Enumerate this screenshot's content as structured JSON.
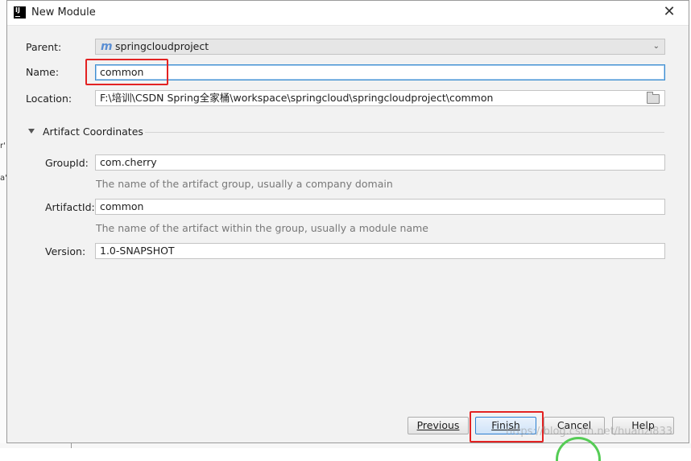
{
  "window": {
    "title": "New Module",
    "app_icon_text": "IJ",
    "close_glyph": "✕"
  },
  "form": {
    "parent_label": "Parent:",
    "parent_value": "springcloudproject",
    "parent_icon": "m",
    "name_label": "Name:",
    "name_value": "common",
    "location_label": "Location:",
    "location_value": "F:\\培训\\CSDN Spring全家桶\\workspace\\springcloud\\springcloudproject\\common"
  },
  "artifact": {
    "section_title": "Artifact Coordinates",
    "groupid_label": "GroupId:",
    "groupid_value": "com.cherry",
    "groupid_hint": "The name of the artifact group, usually a company domain",
    "artifactid_label": "ArtifactId:",
    "artifactid_value": "common",
    "artifactid_hint": "The name of the artifact within the group, usually a module name",
    "version_label": "Version:",
    "version_value": "1.0-SNAPSHOT"
  },
  "buttons": {
    "previous_label": "Previous",
    "finish_label": "Finish",
    "cancel_label": "Cancel",
    "help_label": "Help"
  },
  "background": {
    "left_glyph_1": "r'",
    "left_glyph_2": "a'",
    "watermark": "https://blog.csdn.net/huanzi833"
  },
  "colors": {
    "highlight": "#e32222",
    "focus_border": "#3e8ed0",
    "maven_icon": "#5a8ed3"
  }
}
